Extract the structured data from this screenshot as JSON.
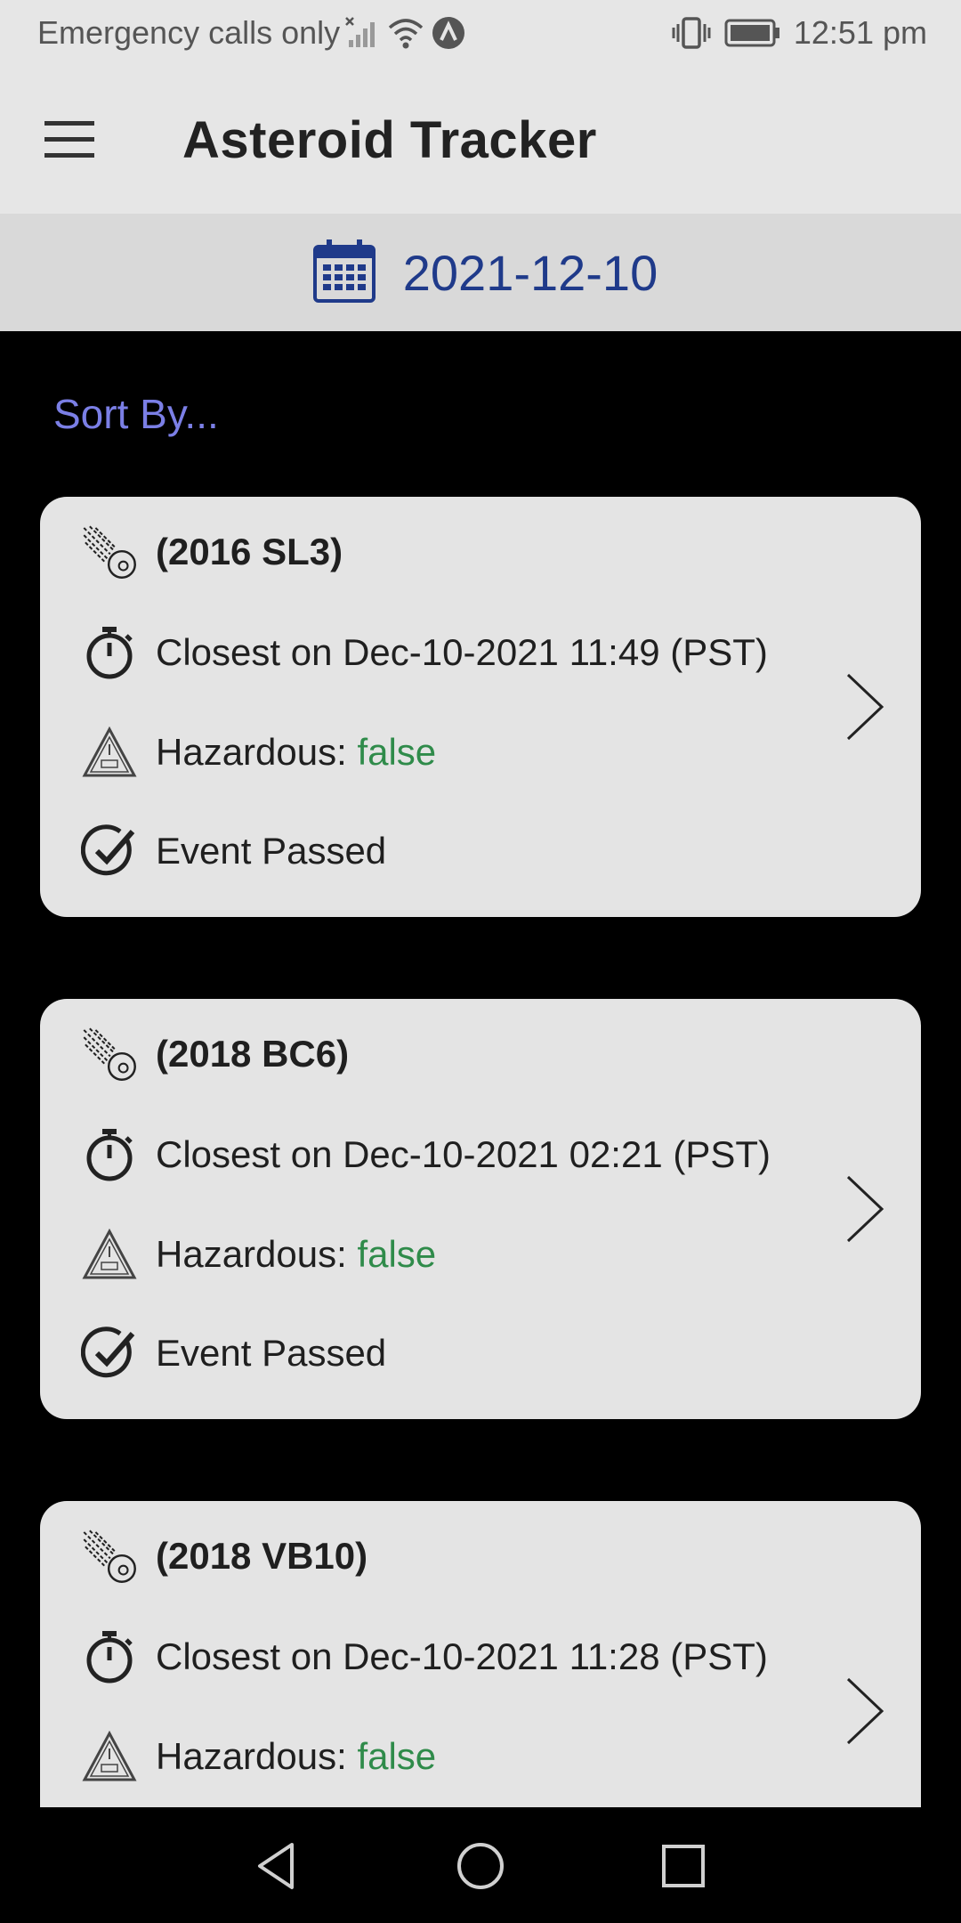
{
  "status_bar": {
    "carrier": "Emergency calls only",
    "time": "12:51 pm"
  },
  "app_bar": {
    "title": "Asteroid Tracker",
    "menu_icon": "hamburger-menu-icon"
  },
  "date_bar": {
    "date": "2021-12-10",
    "icon": "calendar-icon"
  },
  "sort_label": "Sort By...",
  "colors": {
    "date_text": "#1f3a8a",
    "sort_text": "#7b7fe6",
    "hazard_false": "#2f8b4a",
    "event_passed": "#ee6a3c",
    "card_bg": "#e4e4e4"
  },
  "cards": [
    {
      "name": "(2016 SL3)",
      "closest": "Closest on Dec-10-2021 11:49 (PST)",
      "hazard_label": "Hazardous: ",
      "hazard_value": "false",
      "status": "Event Passed"
    },
    {
      "name": "(2018 BC6)",
      "closest": "Closest on Dec-10-2021 02:21 (PST)",
      "hazard_label": "Hazardous: ",
      "hazard_value": "false",
      "status": "Event Passed"
    },
    {
      "name": "(2018 VB10)",
      "closest": "Closest on Dec-10-2021 11:28 (PST)",
      "hazard_label": "Hazardous: ",
      "hazard_value": "false"
    }
  ]
}
